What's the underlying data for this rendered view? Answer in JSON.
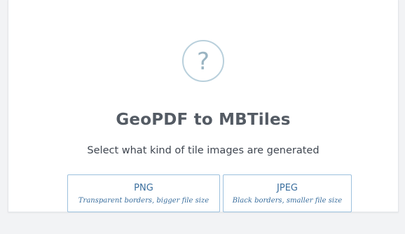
{
  "status": {
    "icon": "question-mark-icon",
    "glyph": "?"
  },
  "header": {
    "title": "GeoPDF to MBTiles",
    "subtitle": "Select what kind of tile images are generated"
  },
  "options": [
    {
      "label": "PNG",
      "description": "Transparent borders, bigger file size"
    },
    {
      "label": "JPEG",
      "description": "Black borders, smaller file size"
    }
  ],
  "colors": {
    "accent": "#3b6f9e",
    "border": "#9cc0dd",
    "title": "#545b64"
  }
}
